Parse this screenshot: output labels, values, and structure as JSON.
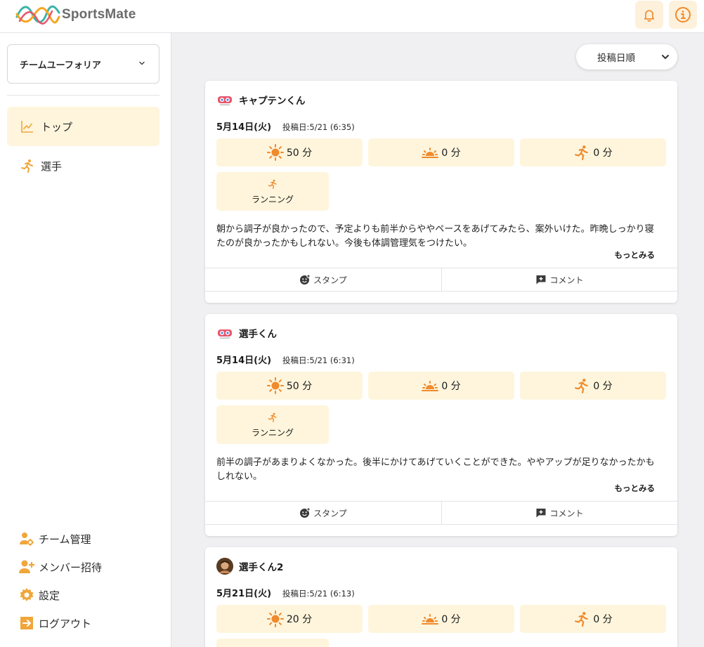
{
  "app": {
    "name": "SportsMate"
  },
  "colors": {
    "accent": "#f08a2c",
    "accent_light": "#fef5dc",
    "brand_teal": "#3cb3a8"
  },
  "sidebar": {
    "team": "チームユーフォリア",
    "nav": [
      {
        "label": "トップ",
        "icon": "chart-line-icon",
        "active": true
      },
      {
        "label": "選手",
        "icon": "runner-icon",
        "active": false
      }
    ],
    "bottom": [
      {
        "label": "チーム管理",
        "icon": "team-settings-icon"
      },
      {
        "label": "メンバー招待",
        "icon": "user-plus-icon"
      },
      {
        "label": "設定",
        "icon": "gear-icon"
      },
      {
        "label": "ログアウト",
        "icon": "logout-icon"
      }
    ]
  },
  "sort": {
    "label": "投稿日順"
  },
  "posts": [
    {
      "user": "キャプテンくん",
      "date": "5月14日(火)",
      "posted": "投稿日:5/21 (6:35)",
      "metrics": [
        "50 分",
        "0 分",
        "0 分"
      ],
      "activity": "ランニング",
      "body": "朝から調子が良かったので、予定よりも前半からややペースをあげてみたら、案外いけた。昨晩しっかり寝たのが良かったかもしれない。今後も体調管理気をつけたい。",
      "more": "もっとみる",
      "stamp": "スタンプ",
      "comment": "コメント"
    },
    {
      "user": "選手くん",
      "date": "5月14日(火)",
      "posted": "投稿日:5/21 (6:31)",
      "metrics": [
        "50 分",
        "0 分",
        "0 分"
      ],
      "activity": "ランニング",
      "body": "前半の調子があまりよくなかった。後半にかけてあげていくことができた。ややアップが足りなかったかもしれない。",
      "more": "もっとみる",
      "stamp": "スタンプ",
      "comment": "コメント"
    },
    {
      "user": "選手くん2",
      "date": "5月21日(火)",
      "posted": "投稿日:5/21 (6:13)",
      "metrics": [
        "20 分",
        "0 分",
        "0 分"
      ]
    }
  ]
}
